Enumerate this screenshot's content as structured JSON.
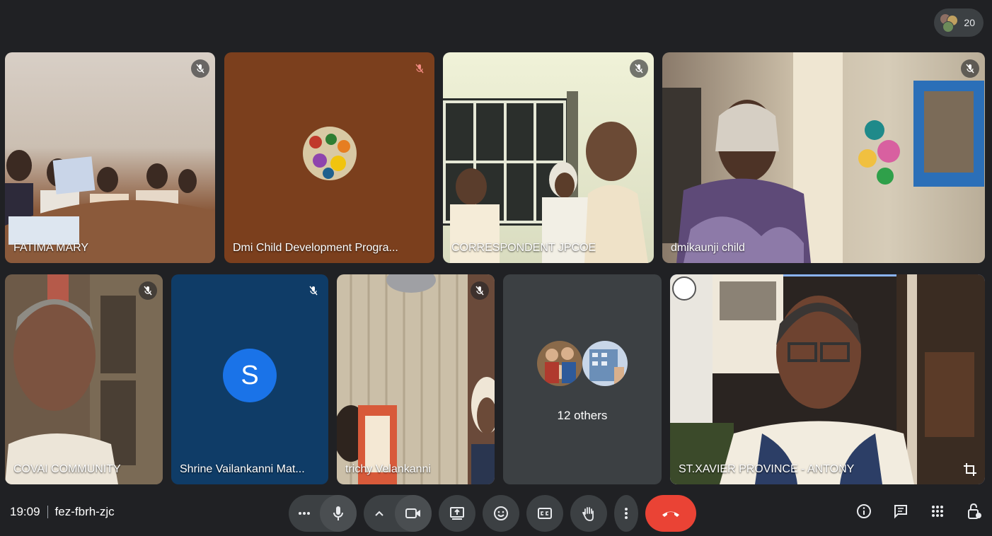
{
  "participant_count": "20",
  "tiles": [
    {
      "name": "FATIMA MARY"
    },
    {
      "name": "Dmi Child Development Progra..."
    },
    {
      "name": "CORRESPONDENT JPCOE"
    },
    {
      "name": "dmikaunji child"
    },
    {
      "name": "COVAI COMMUNITY"
    },
    {
      "name": "Shrine Vailankanni Mat...",
      "initial": "S"
    },
    {
      "name": "trichy Velankanni"
    },
    {
      "name": "12 others"
    },
    {
      "name": "ST.XAVIER PROVINCE - ANTONY"
    }
  ],
  "meeting": {
    "time": "19:09",
    "code": "fez-fbrh-zjc"
  },
  "colors": {
    "background": "#202124",
    "control": "#3c4043",
    "end_call": "#ea4335",
    "avatar": "#1a73e8",
    "active_border": "#8ab4f8"
  },
  "icons": [
    "participants-avatars",
    "mic-off-icon",
    "more-options-icon",
    "mic-icon",
    "chevron-up-icon",
    "camera-icon",
    "present-icon",
    "emoji-icon",
    "captions-icon",
    "raise-hand-icon",
    "more-vert-icon",
    "end-call-icon",
    "info-icon",
    "chat-icon",
    "apps-icon",
    "host-controls-icon",
    "crop-icon"
  ]
}
